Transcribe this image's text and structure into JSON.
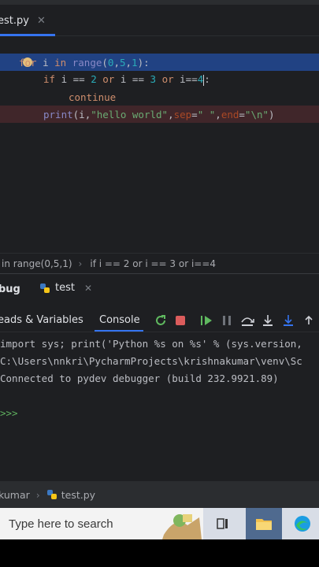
{
  "editor_tab": {
    "label": "est.py",
    "close": "✕"
  },
  "code": {
    "line1": {
      "kw1": "for",
      "sp": " i ",
      "kw2": "in",
      "fn": "range",
      "open": "(",
      "n1": "0",
      "c1": ",",
      "n2": "5",
      "c2": ",",
      "n3": "1",
      "close": "):"
    },
    "line2": {
      "kw1": "if",
      "a": " i == ",
      "n1": "2",
      "kw2": "or",
      "b": " i == ",
      "n2": "3",
      "kw3": "or",
      "c": " i==",
      "n3": "4",
      "colon": ":"
    },
    "line3": {
      "kw": "continue"
    },
    "line4": {
      "fn": "print",
      "a": "(i,",
      "str1": "\"hello world\"",
      "c1": ",",
      "p1": "sep",
      "eq1": "=",
      "str2": "\" \"",
      "c2": ",",
      "p2": "end",
      "eq2": "=",
      "str3": "\"\\n\"",
      "close": ")"
    }
  },
  "breadcrumbs": {
    "item1": "in range(0,5,1)",
    "sep": "›",
    "item2": "if i == 2 or i == 3 or i==4"
  },
  "debug": {
    "title": "bug",
    "tab_label": "test",
    "tab_close": "✕",
    "toolbar": {
      "threads": "eads & Variables",
      "console": "Console"
    }
  },
  "console": {
    "line1": "import sys; print('Python %s on %s' % (sys.version,",
    "line2": "C:\\Users\\nnkri\\PycharmProjects\\krishnakumar\\venv\\Sc",
    "line3": "Connected to pydev debugger (build 232.9921.89)",
    "prompt": ">>>"
  },
  "statusbar": {
    "item1": "kumar",
    "sep": "›",
    "item2": "test.py"
  },
  "taskbar": {
    "search_placeholder": "Type here to search"
  },
  "colors": {
    "accent": "#3574f0",
    "debug_line": "#214283",
    "breakpoint_line": "#40262a",
    "editor_bg": "#1e1f22"
  }
}
